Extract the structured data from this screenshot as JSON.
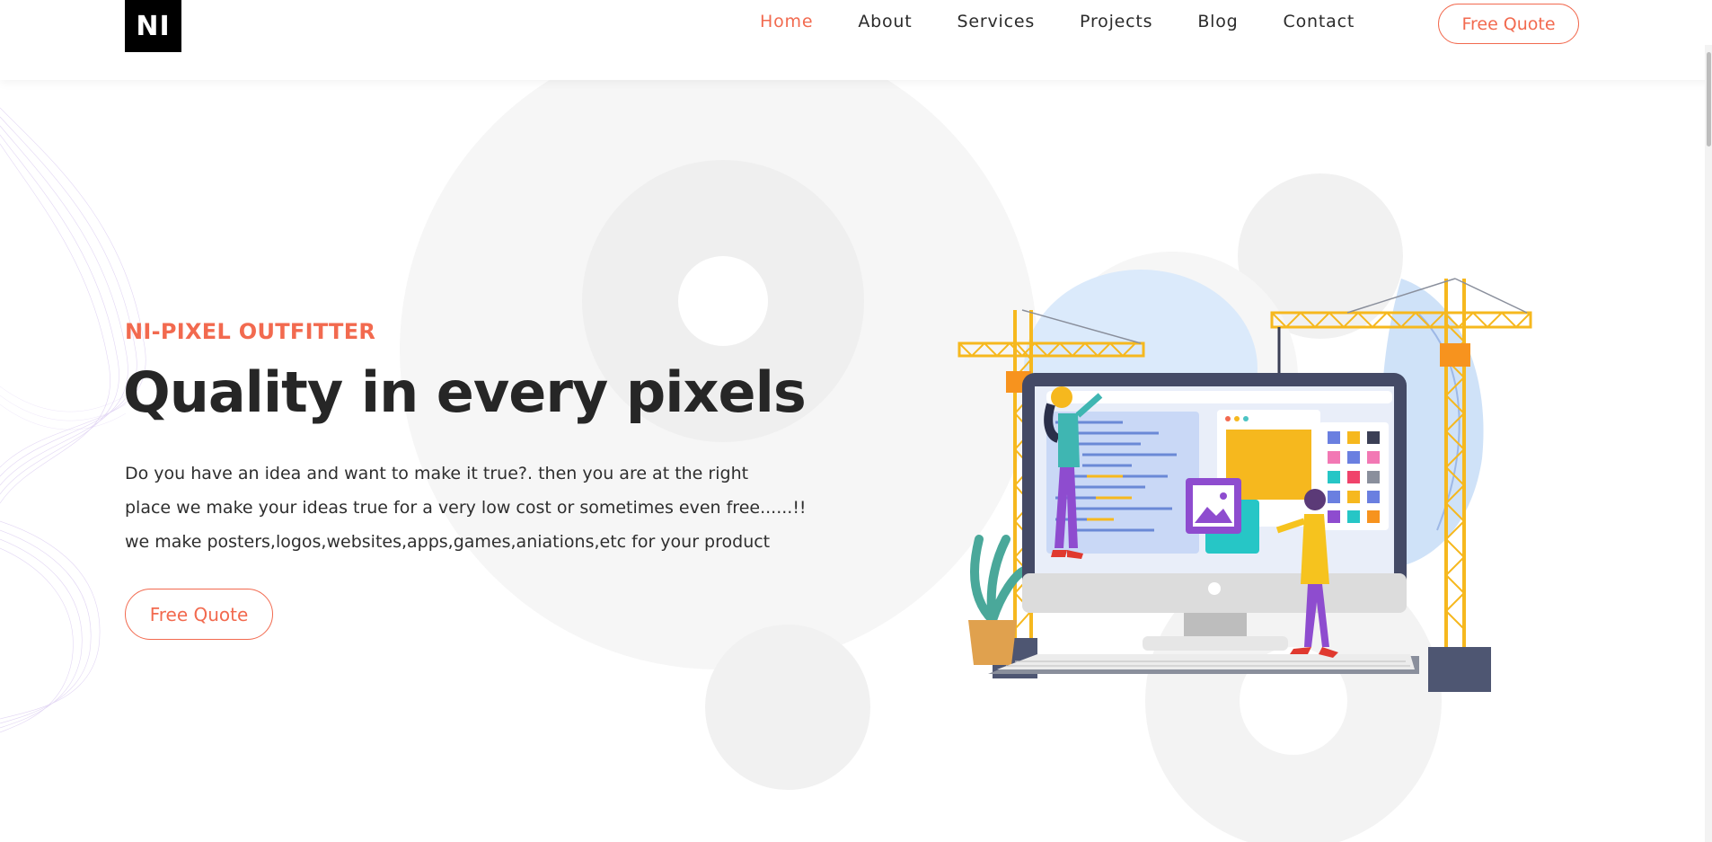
{
  "header": {
    "logo_text": "NI",
    "nav": [
      {
        "label": "Home",
        "active": true
      },
      {
        "label": "About",
        "active": false
      },
      {
        "label": "Services",
        "active": false
      },
      {
        "label": "Projects",
        "active": false
      },
      {
        "label": "Blog",
        "active": false
      },
      {
        "label": "Contact",
        "active": false
      }
    ],
    "cta_label": "Free Quote"
  },
  "hero": {
    "eyebrow": "NI-PIXEL OUTFITTER",
    "headline": "Quality in every pixels",
    "description_lines": [
      "Do you have an idea and want to make it true?. then you are at the right",
      "place we make your ideas true for a very low cost or sometimes even free......!!",
      "we make posters,logos,websites,apps,games,aniations,etc for your product"
    ],
    "cta_label": "Free Quote"
  },
  "colors": {
    "accent": "#f26a4f",
    "text": "#262626",
    "crane": "#f6b81e"
  },
  "icons": [
    "construction-illustration"
  ]
}
